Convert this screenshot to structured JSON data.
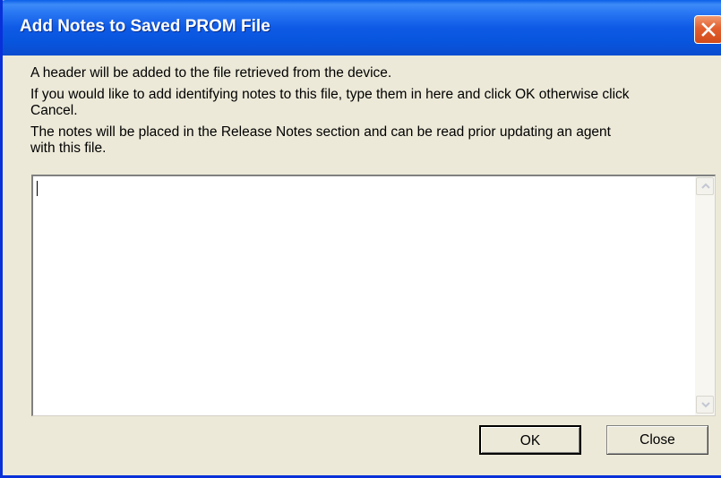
{
  "window": {
    "title": "Add Notes to Saved PROM File",
    "close_icon": "close-icon"
  },
  "messages": {
    "line1": "A header will be added to the file retrieved from the device.",
    "line2a": "If you would like to add identifying notes to this file, type them in here and click OK otherwise click",
    "line2b": "Cancel.",
    "line3a": "The notes will be placed in the Release Notes section and can be read prior updating an agent",
    "line3b": "with this file."
  },
  "notes": {
    "value": ""
  },
  "buttons": {
    "ok_label": "OK",
    "close_label": "Close"
  },
  "colors": {
    "titlebar": "#0A5FE8",
    "close_button": "#E25F2E",
    "dialog_background": "#ECE9D8"
  }
}
